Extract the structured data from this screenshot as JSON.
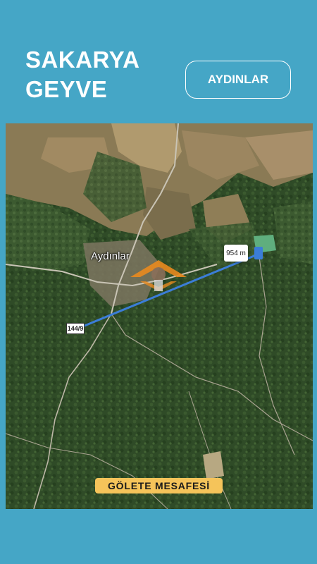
{
  "header": {
    "line1": "SAKARYA",
    "line2": "GEYVE",
    "village_button": "AYDINLAR"
  },
  "map": {
    "place_label": "Aydınlar",
    "distance_label": "954 m",
    "road_label": "144/9",
    "caption": "GÖLETE MESAFESİ",
    "measure_line_color": "#3b7dd8",
    "caption_color": "#f5c45a",
    "background_color": "#45a6c6"
  }
}
